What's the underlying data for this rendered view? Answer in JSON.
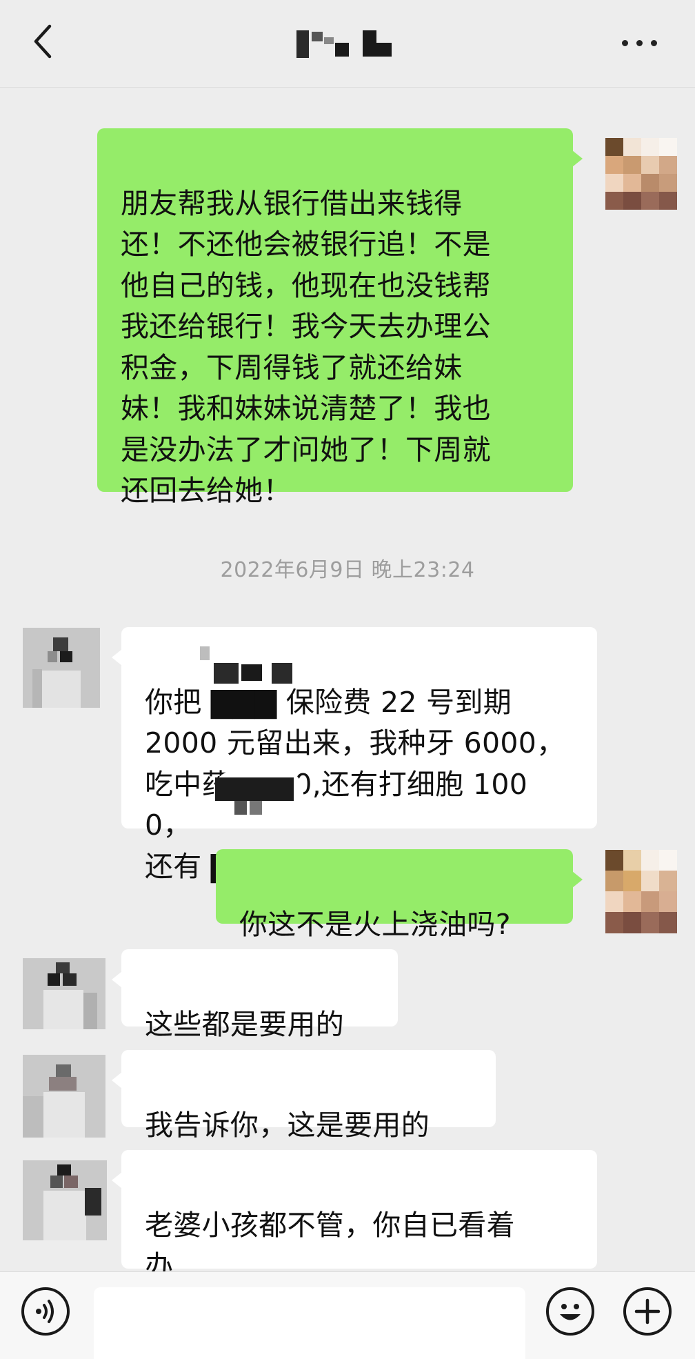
{
  "header": {
    "title": "",
    "back_icon": "chevron-left-icon",
    "more_icon": "more-dots-icon"
  },
  "messages": [
    {
      "sender": "me",
      "text": "朋友帮我从银行借出来钱得\n还！不还他会被银行追！不是\n他自己的钱，他现在也没钱帮\n我还给银行！我今天去办理公\n积金，下周得钱了就还给妹\n妹！我和妹妹说清楚了！我也\n是没办法了才问她了！下周就\n还回去给她！"
    },
    {
      "type": "timestamp",
      "text": "2022年6月9日 晚上23:24"
    },
    {
      "sender": "them",
      "text": "你把 ▇▇▇ 保险费 22 号到期\n2000 元留出来，我种牙 6000，\n吃中药 1000,还有打细胞 1000，\n还有 ▇▇▇ 学费 6000 留出来。"
    },
    {
      "sender": "me",
      "text": "你这不是火上浇油吗?"
    },
    {
      "sender": "them",
      "text": "这些都是要用的"
    },
    {
      "sender": "them",
      "text": "我告诉你，这是要用的"
    },
    {
      "sender": "them",
      "text": "老婆小孩都不管，你自已看着\n办"
    }
  ],
  "inputbar": {
    "voice_icon": "voice-icon",
    "emoji_icon": "emoji-icon",
    "add_icon": "plus-icon",
    "input_value": ""
  },
  "colors": {
    "background": "#ededed",
    "my_bubble": "#95ec69",
    "their_bubble": "#ffffff",
    "timestamp": "#9d9d9d"
  }
}
